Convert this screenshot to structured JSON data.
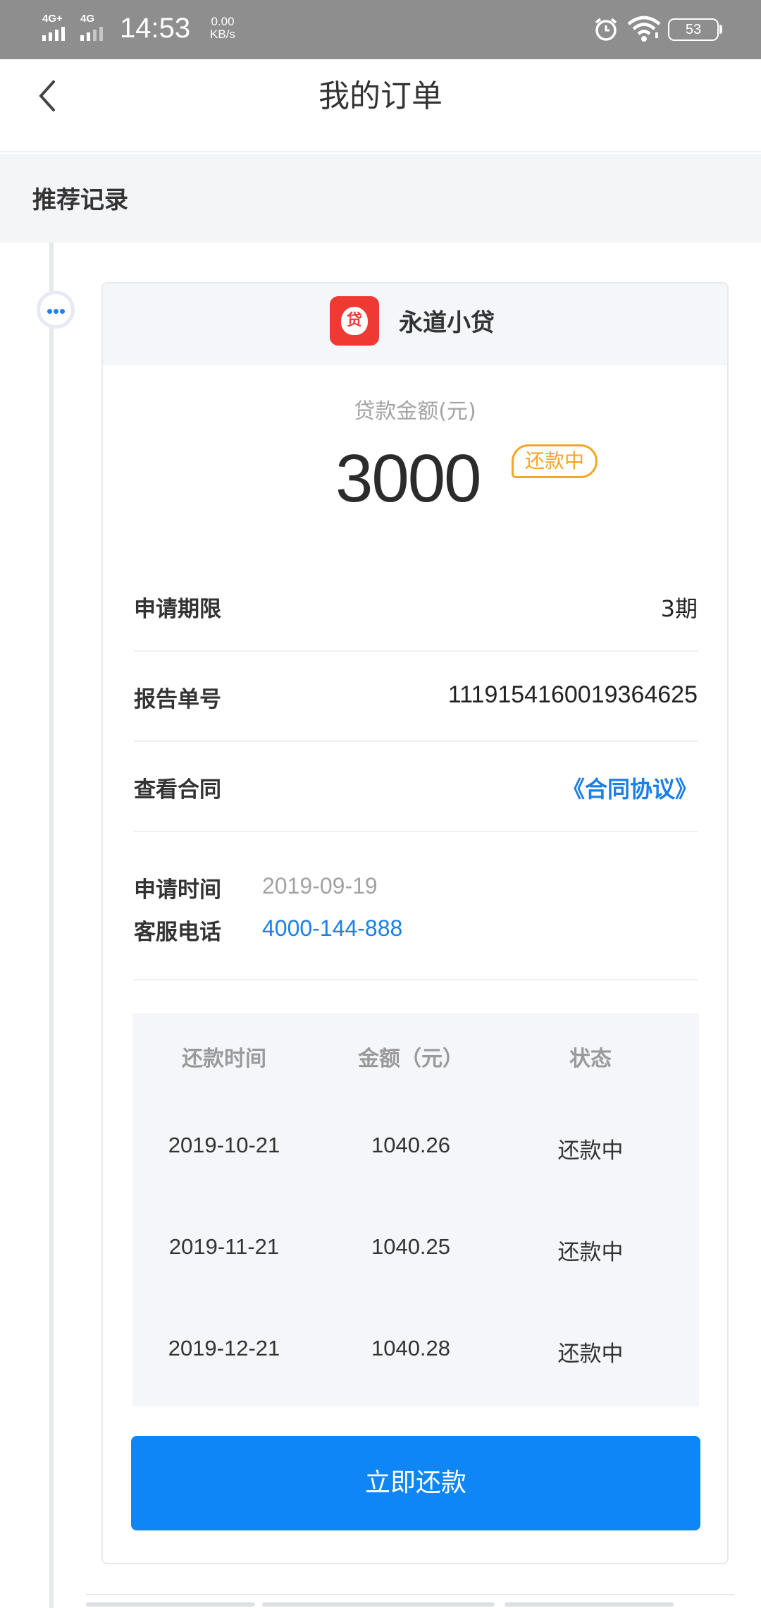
{
  "status_bar": {
    "signal1_tag": "4G+",
    "signal2_tag": "4G",
    "time": "14:53",
    "speed_value": "0.00",
    "speed_unit": "KB/s",
    "battery": "53"
  },
  "nav": {
    "title": "我的订单"
  },
  "section": {
    "title": "推荐记录"
  },
  "order": {
    "lender_logo_char": "贷",
    "lender_name": "永道小贷",
    "amount_label": "贷款金额(元)",
    "amount": "3000",
    "status": "还款中",
    "rows": [
      {
        "label": "申请期限",
        "value": "3期"
      },
      {
        "label": "报告单号",
        "value": "111915416001936462​5"
      },
      {
        "label": "查看合同",
        "value": "《合同协议》"
      }
    ],
    "apply_time_label": "申请时间",
    "apply_time": "2019-09-19",
    "service_phone_label": "客服电话",
    "service_phone": "4000-144-888",
    "table": {
      "headers": [
        "还款时间",
        "金额（元）",
        "状态"
      ],
      "rows": [
        [
          "2019-10-21",
          "1040.26",
          "还款中"
        ],
        [
          "2019-11-21",
          "1040.25",
          "还款中"
        ],
        [
          "2019-12-21",
          "1040.28",
          "还款中"
        ]
      ]
    },
    "repay_button": "立即还款"
  },
  "colors": {
    "accent": "#0f86f5",
    "link": "#1a7fe6",
    "badge": "#f5a623",
    "logo": "#ee3a33"
  },
  "icons": [
    "signal-icon",
    "alarm-icon",
    "wifi-icon",
    "battery-icon",
    "back-arrow-icon",
    "more-dots-icon",
    "loan-logo-icon"
  ]
}
